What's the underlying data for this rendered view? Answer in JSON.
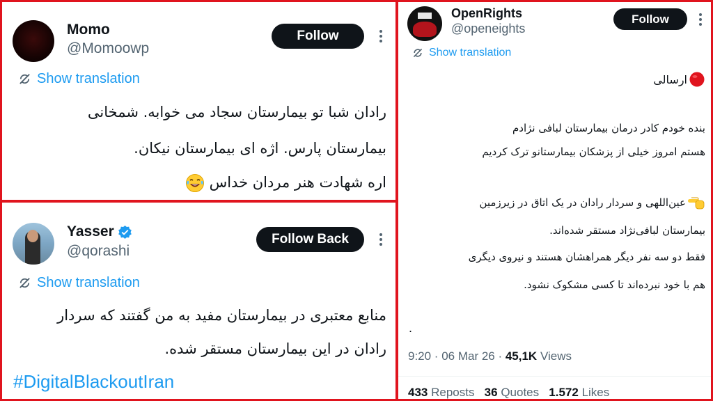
{
  "tweet1": {
    "name": "Momo",
    "handle": "@Momoowp",
    "follow_label": "Follow",
    "translation_label": "Show translation",
    "lines": [
      "رادان شبا تو بیمارستان سجاد می خوابه. شمخانی",
      "بیمارستان پارس. اژه ای بیمارستان نیکان.",
      "اره شهادت هنر مردان خداس"
    ],
    "emoji_icon": "laughing-tears-icon"
  },
  "tweet2": {
    "name": "Yasser",
    "handle": "@qorashi",
    "follow_label": "Follow Back",
    "translation_label": "Show translation",
    "lines": [
      "منابع معتبری در بیمارستان مفید به من گفتند که سردار",
      "رادان در این بیمارستان مستقر شده."
    ],
    "hashtag": "#DigitalBlackoutIran",
    "verified_icon": "verified-badge-icon"
  },
  "tweet3": {
    "name": "OpenRights",
    "handle": "@openeights",
    "follow_label": "Follow",
    "translation_label": "Show translation",
    "line_title": "ارسالی",
    "line_a1": "بنده خودم کادر درمان بیمارستان لبافی نژادم",
    "line_a2": "هستم امروز  خیلی از پزشکان بیمارستانو ترک کردیم",
    "line_b1": "عین‌اللهی و سردار رادان در یک اتاق در زیرزمین",
    "line_b2": "بیمارستان لبافی‌نژاد مستقر شده‌اند.",
    "line_b3": "فقط دو سه نفر دیگر همراهشان هستند و نیروی دیگری",
    "line_b4": "هم با خود نبرده‌اند تا کسی مشکوک نشود.",
    "dot": ".",
    "time": "9:20 · 06 Mar 26 · ",
    "views_count": "45,1K",
    "views_label": "Views",
    "reposts_count": "433",
    "reposts_label": "Reposts",
    "quotes_count": "36",
    "quotes_label": "Quotes",
    "likes_count": "1.572",
    "likes_label": "Likes",
    "red_circle_icon": "red-circle-icon",
    "pointing_hand_icon": "pointing-hand-icon",
    "accent": "#1d9bf0",
    "border": "#e0141e"
  }
}
